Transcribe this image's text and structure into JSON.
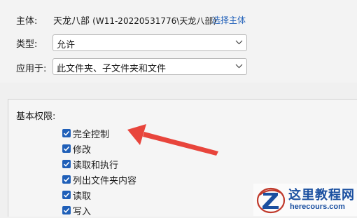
{
  "principal": {
    "label": "主体:",
    "name": "天龙八部",
    "account": "(W11-20220531776\\天龙八部)",
    "select_link": "选择主体"
  },
  "type_field": {
    "label": "类型:",
    "value": "允许"
  },
  "applies_to": {
    "label": "应用于:",
    "value": "此文件夹、子文件夹和文件"
  },
  "basic_permissions": {
    "heading": "基本权限:",
    "items": [
      {
        "label": "完全控制",
        "checked": true
      },
      {
        "label": "修改",
        "checked": true
      },
      {
        "label": "读取和执行",
        "checked": true
      },
      {
        "label": "列出文件夹内容",
        "checked": true
      },
      {
        "label": "读取",
        "checked": true
      },
      {
        "label": "写入",
        "checked": true
      }
    ]
  },
  "annotation": {
    "arrow_color": "#e8453c",
    "points_to": "完全控制"
  },
  "watermark": {
    "title": "这里教程网",
    "url": "herecours.com",
    "emblem_icon": "z-circle-logo"
  },
  "colors": {
    "accent": "#1f5fb8",
    "arrow": "#e8453c",
    "watermark": "#1a4fa0"
  }
}
